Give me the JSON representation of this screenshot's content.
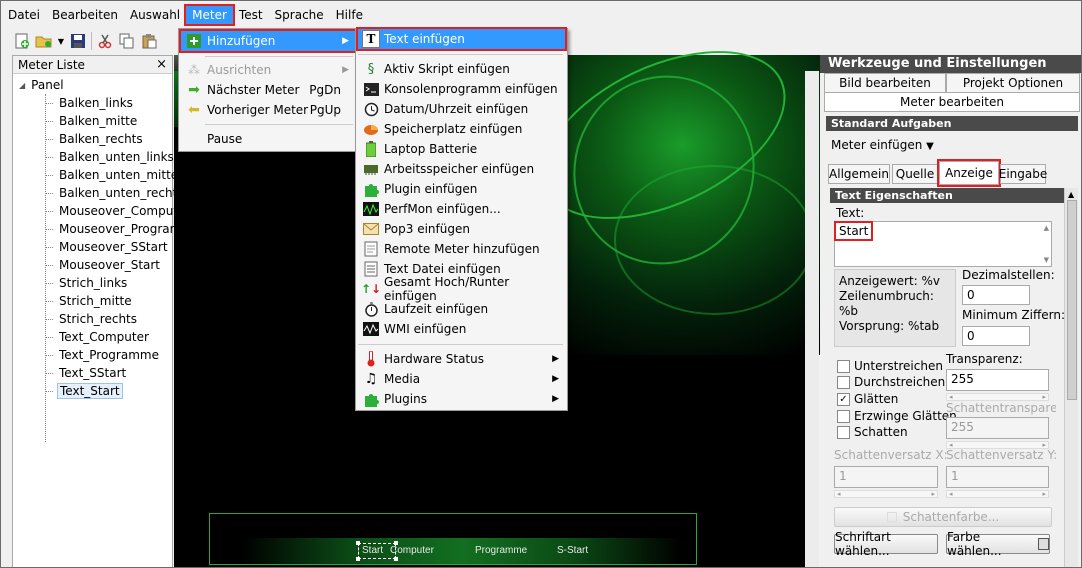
{
  "menubar": {
    "items": [
      "Datei",
      "Bearbeiten",
      "Auswahl",
      "Meter",
      "Test",
      "Sprache",
      "Hilfe"
    ]
  },
  "meter_list": {
    "title": "Meter Liste",
    "close": "×",
    "root": "Panel",
    "items": [
      "Balken_links",
      "Balken_mitte",
      "Balken_rechts",
      "Balken_unten_links",
      "Balken_unten_mitte",
      "Balken_unten_rechts",
      "Mouseover_Computer",
      "Mouseover_Programme",
      "Mouseover_SStart",
      "Mouseover_Start",
      "Strich_links",
      "Strich_mitte",
      "Strich_rechts",
      "Text_Computer",
      "Text_Programme",
      "Text_SStart",
      "Text_Start"
    ]
  },
  "meter_menu": {
    "add": "Hinzufügen",
    "align": "Ausrichten",
    "next": "Nächster Meter",
    "next_shortcut": "PgDn",
    "prev": "Vorheriger Meter",
    "prev_shortcut": "PgUp",
    "pause": "Pause"
  },
  "add_submenu": {
    "items": [
      "Text einfügen",
      "Aktiv Skript einfügen",
      "Konsolenprogramm einfügen",
      "Datum/Uhrzeit einfügen",
      "Speicherplatz einfügen",
      "Laptop Batterie",
      "Arbeitsspeicher einfügen",
      "Plugin einfügen",
      "PerfMon einfügen...",
      "Pop3 einfügen",
      "Remote Meter hinzufügen",
      "Text Datei einfügen",
      "Gesamt Hoch/Runter einfügen",
      "Laufzeit einfügen",
      "WMI einfügen"
    ],
    "groups": [
      "Hardware Status",
      "Media",
      "Plugins"
    ]
  },
  "preview": {
    "labels": [
      "Start",
      "Computer",
      "Programme",
      "S-Start"
    ]
  },
  "panel": {
    "title": "Werkzeuge und Einstellungen",
    "tab_edit_image": "Bild bearbeiten",
    "tab_project_options": "Projekt Optionen",
    "tab_edit_meter": "Meter bearbeiten",
    "section_standard": "Standard Aufgaben",
    "insert_meter": "Meter einfügen",
    "subtabs": [
      "Allgemein",
      "Quelle",
      "Anzeige",
      "Eingabe"
    ],
    "section_text": "Text Eigenschaften",
    "text_label": "Text:",
    "text_value": "Start",
    "info_value": "Anzeigewert: %v",
    "info_wrap": "Zeilenumbruch: %b",
    "info_tab": "Vorsprung: %tab",
    "decimals_label": "Dezimalstellen:",
    "decimals_value": "0",
    "min_digits_label": "Minimum Ziffern:",
    "min_digits_value": "0",
    "underline": "Unterstreichen",
    "strikethrough": "Durchstreichen",
    "smooth": "Glätten",
    "force_smooth": "Erzwinge Glätten",
    "shadow": "Schatten",
    "transparency_label": "Transparenz:",
    "transparency_value": "255",
    "shadow_transparency_label": "Schattentransparenz:",
    "shadow_transparency_value": "255",
    "shadow_offset_x_label": "Schattenversatz X:",
    "shadow_offset_x_value": "1",
    "shadow_offset_y_label": "Schattenversatz Y:",
    "shadow_offset_y_value": "1",
    "shadow_color_button": "Schattenfarbe...",
    "font_button": "Schriftart wählen...",
    "color_button": "Farbe wählen..."
  },
  "colors": {
    "highlight": "#3399ff",
    "annotation": "#e02020",
    "accent_green": "#22b238"
  }
}
